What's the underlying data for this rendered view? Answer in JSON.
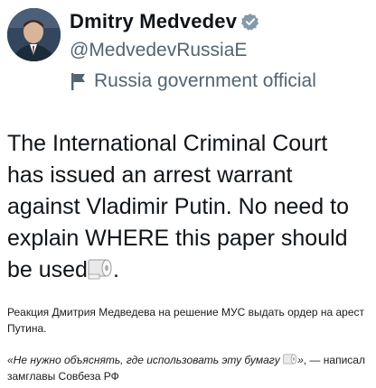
{
  "header": {
    "name": "Dmitry Medvedev",
    "handle": "@MedvedevRussiaE",
    "label": "Russia government official"
  },
  "tweet": {
    "text": "The International Criminal Court has issued an arrest warrant against Vladimir Putin. No need to explain WHERE this paper should be used",
    "end_punct": "."
  },
  "caption": {
    "text": "Реакция Дмитрия Медведева на решение МУС выдать ордер на арест Путина."
  },
  "quote": {
    "italic_text": "«Не нужно объяснять, где использовать эту бумагу",
    "close_quote": "»",
    "rest": ", — написал замглавы Совбеза РФ"
  },
  "colors": {
    "verified": "#829aab",
    "secondary_text": "#536471"
  }
}
